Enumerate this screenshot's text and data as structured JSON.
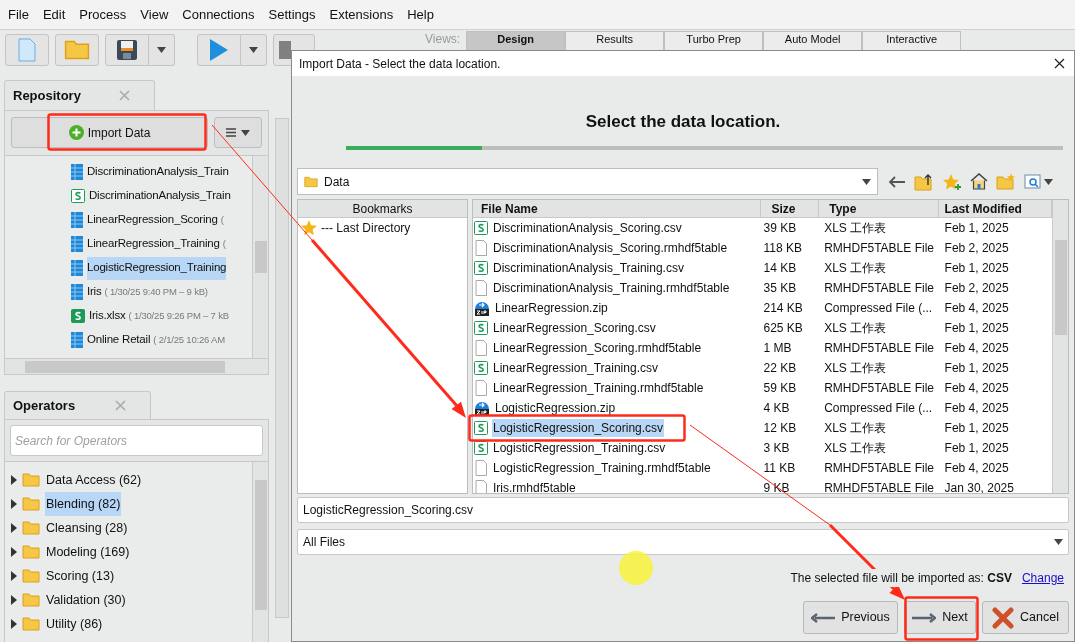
{
  "menu": [
    "File",
    "Edit",
    "Process",
    "View",
    "Connections",
    "Settings",
    "Extensions",
    "Help"
  ],
  "views": {
    "label": "Views:",
    "tabs": [
      {
        "label": "Design",
        "selected": true
      },
      {
        "label": "Results",
        "selected": false
      },
      {
        "label": "Turbo Prep",
        "selected": false
      },
      {
        "label": "Auto Model",
        "selected": false
      },
      {
        "label": "Interactive",
        "selected": false
      }
    ]
  },
  "repository": {
    "title": "Repository",
    "import_button": "Import Data",
    "items": [
      {
        "kind": "table",
        "name": "DiscriminationAnalysis_Train",
        "selected": false
      },
      {
        "kind": "csv",
        "name": "DiscriminationAnalysis_Train",
        "selected": false
      },
      {
        "kind": "table",
        "name": "LinearRegression_Scoring",
        "meta": "(",
        "selected": false
      },
      {
        "kind": "table",
        "name": "LinearRegression_Training",
        "meta": "(",
        "selected": false
      },
      {
        "kind": "table",
        "name": "LogisticRegression_Training",
        "selected": true
      },
      {
        "kind": "table",
        "name": "Iris",
        "meta": "( 1/30/25 9:40 PM – 9 kB)",
        "selected": false
      },
      {
        "kind": "xlsx",
        "name": "Iris.xlsx",
        "meta": "( 1/30/25 9:26 PM – 7 kB",
        "selected": false
      },
      {
        "kind": "table",
        "name": "Online Retail",
        "meta": "( 2/1/25 10:26 AM",
        "selected": false
      }
    ]
  },
  "operators": {
    "title": "Operators",
    "search": {
      "placeholder": "Search for Operators"
    },
    "groups": [
      {
        "label": "Data Access (62)",
        "selected": false
      },
      {
        "label": "Blending (82)",
        "selected": true
      },
      {
        "label": "Cleansing (28)",
        "selected": false
      },
      {
        "label": "Modeling (169)",
        "selected": false
      },
      {
        "label": "Scoring (13)",
        "selected": false
      },
      {
        "label": "Validation (30)",
        "selected": false
      },
      {
        "label": "Utility (86)",
        "selected": false
      }
    ]
  },
  "dialog": {
    "title": "Import Data - Select the data location.",
    "heading": "Select the data location.",
    "progress": {
      "level": 0.19
    },
    "location": "Data",
    "bookmarks": {
      "header": "Bookmarks",
      "items": [
        "--- Last Directory"
      ]
    },
    "columns": [
      "File Name",
      "Size",
      "Type",
      "Last Modified"
    ],
    "files": [
      {
        "kind": "csv",
        "name": "DiscriminationAnalysis_Scoring.csv",
        "size": "39 KB",
        "type": "XLS 工作表",
        "modified": "Feb 1, 2025",
        "selected": false
      },
      {
        "kind": "file",
        "name": "DiscriminationAnalysis_Scoring.rmhdf5table",
        "size": "118 KB",
        "type": "RMHDF5TABLE File",
        "modified": "Feb 2, 2025",
        "selected": false
      },
      {
        "kind": "csv",
        "name": "DiscriminationAnalysis_Training.csv",
        "size": "14 KB",
        "type": "XLS 工作表",
        "modified": "Feb 1, 2025",
        "selected": false
      },
      {
        "kind": "file",
        "name": "DiscriminationAnalysis_Training.rmhdf5table",
        "size": "35 KB",
        "type": "RMHDF5TABLE File",
        "modified": "Feb 2, 2025",
        "selected": false
      },
      {
        "kind": "zip",
        "name": "LinearRegression.zip",
        "size": "214 KB",
        "type": "Compressed File (...",
        "modified": "Feb 4, 2025",
        "selected": false
      },
      {
        "kind": "csv",
        "name": "LinearRegression_Scoring.csv",
        "size": "625 KB",
        "type": "XLS 工作表",
        "modified": "Feb 1, 2025",
        "selected": false
      },
      {
        "kind": "file",
        "name": "LinearRegression_Scoring.rmhdf5table",
        "size": "1 MB",
        "type": "RMHDF5TABLE File",
        "modified": "Feb 4, 2025",
        "selected": false
      },
      {
        "kind": "csv",
        "name": "LinearRegression_Training.csv",
        "size": "22 KB",
        "type": "XLS 工作表",
        "modified": "Feb 1, 2025",
        "selected": false
      },
      {
        "kind": "file",
        "name": "LinearRegression_Training.rmhdf5table",
        "size": "59 KB",
        "type": "RMHDF5TABLE File",
        "modified": "Feb 4, 2025",
        "selected": false
      },
      {
        "kind": "zip",
        "name": "LogisticRegression.zip",
        "size": "4 KB",
        "type": "Compressed File (...",
        "modified": "Feb 4, 2025",
        "selected": false
      },
      {
        "kind": "csv",
        "name": "LogisticRegression_Scoring.csv",
        "size": "12 KB",
        "type": "XLS 工作表",
        "modified": "Feb 1, 2025",
        "selected": true
      },
      {
        "kind": "csv",
        "name": "LogisticRegression_Training.csv",
        "size": "3 KB",
        "type": "XLS 工作表",
        "modified": "Feb 1, 2025",
        "selected": false
      },
      {
        "kind": "file",
        "name": "LogisticRegression_Training.rmhdf5table",
        "size": "11 KB",
        "type": "RMHDF5TABLE File",
        "modified": "Feb 4, 2025",
        "selected": false
      },
      {
        "kind": "file",
        "name": "Iris.rmhdf5table",
        "size": "9 KB",
        "type": "RMHDF5TABLE File",
        "modified": "Jan 30, 2025",
        "selected": false
      }
    ],
    "file_name": "LogisticRegression_Scoring.csv",
    "filter": "All Files",
    "import_as": {
      "text": "The selected file will be imported as:",
      "format": "CSV",
      "link": "Change"
    },
    "buttons": {
      "previous": "Previous",
      "next": "Next",
      "cancel": "Cancel"
    }
  }
}
